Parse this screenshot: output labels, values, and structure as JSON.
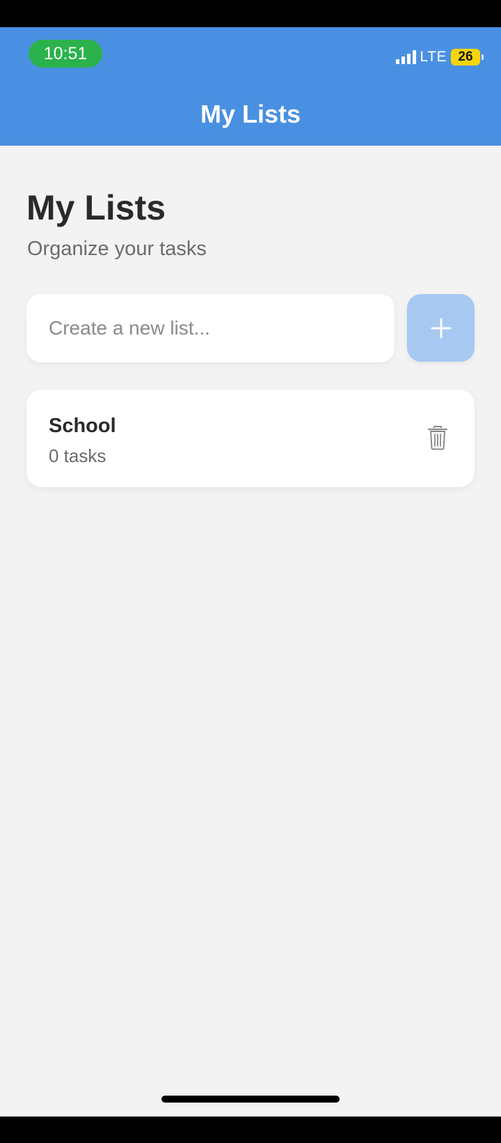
{
  "status_bar": {
    "time": "10:51",
    "network": "LTE",
    "battery": "26"
  },
  "header": {
    "title": "My Lists"
  },
  "main": {
    "title": "My Lists",
    "subtitle": "Organize your tasks",
    "new_list_input": {
      "placeholder": "Create a new list...",
      "value": ""
    },
    "add_button_icon": "plus-icon",
    "lists": [
      {
        "name": "School",
        "count": "0 tasks",
        "delete_icon": "trash-icon"
      }
    ]
  },
  "colors": {
    "header_blue": "#4a90e2",
    "add_button_disabled": "#a7c8f1",
    "time_pill_green": "#2bb24c",
    "battery_yellow": "#f6d40a",
    "background": "#f3f3f3"
  }
}
